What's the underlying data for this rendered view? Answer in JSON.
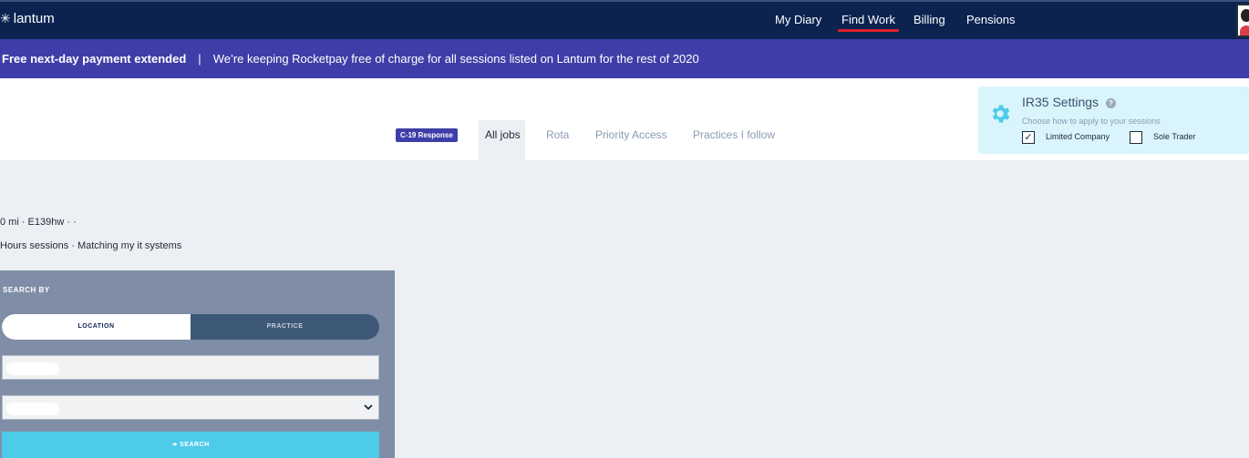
{
  "app": {
    "logo": "lantum"
  },
  "nav": {
    "items": [
      {
        "label": "My Diary"
      },
      {
        "label": "Find Work"
      },
      {
        "label": "Billing"
      },
      {
        "label": "Pensions"
      }
    ],
    "active": "Find Work",
    "accent_color": "#e0202c"
  },
  "banner": {
    "bold": "Free next-day payment extended",
    "separator": "|",
    "text": "We’re keeping Rocketpay free of charge for all sessions listed on Lantum for the rest of 2020"
  },
  "tabs": {
    "badge": "C-19 Response",
    "items": [
      {
        "label": "All jobs"
      },
      {
        "label": "Rota"
      },
      {
        "label": "Priority Access"
      },
      {
        "label": "Practices I follow"
      }
    ],
    "active": "All jobs"
  },
  "ir35": {
    "title": "IR35 Settings",
    "help": "?",
    "subtitle": "Choose how to apply to your sessions",
    "options": [
      {
        "label": "Limited Company",
        "checked": true,
        "mark": "✓"
      },
      {
        "label": "Sole Trader",
        "checked": false,
        "mark": ""
      }
    ],
    "icon": "gear-icon"
  },
  "summary": {
    "line1": "0 mi · E139hw · ·",
    "line2": "Hours sessions · Matching my it systems"
  },
  "search": {
    "heading": "SEARCH BY",
    "toggle": {
      "left": "LOCATION",
      "right": "PRACTICE",
      "selected": "LOCATION"
    },
    "location_value": "",
    "select_value": "",
    "button": "➔ SEARCH"
  },
  "colors": {
    "nav_bg": "#0c2350",
    "banner_bg": "#3e3ea8",
    "panel_bg": "#7f8ea6",
    "search_button": "#4dcbe9",
    "ir35_bg": "#d9f4fb"
  }
}
